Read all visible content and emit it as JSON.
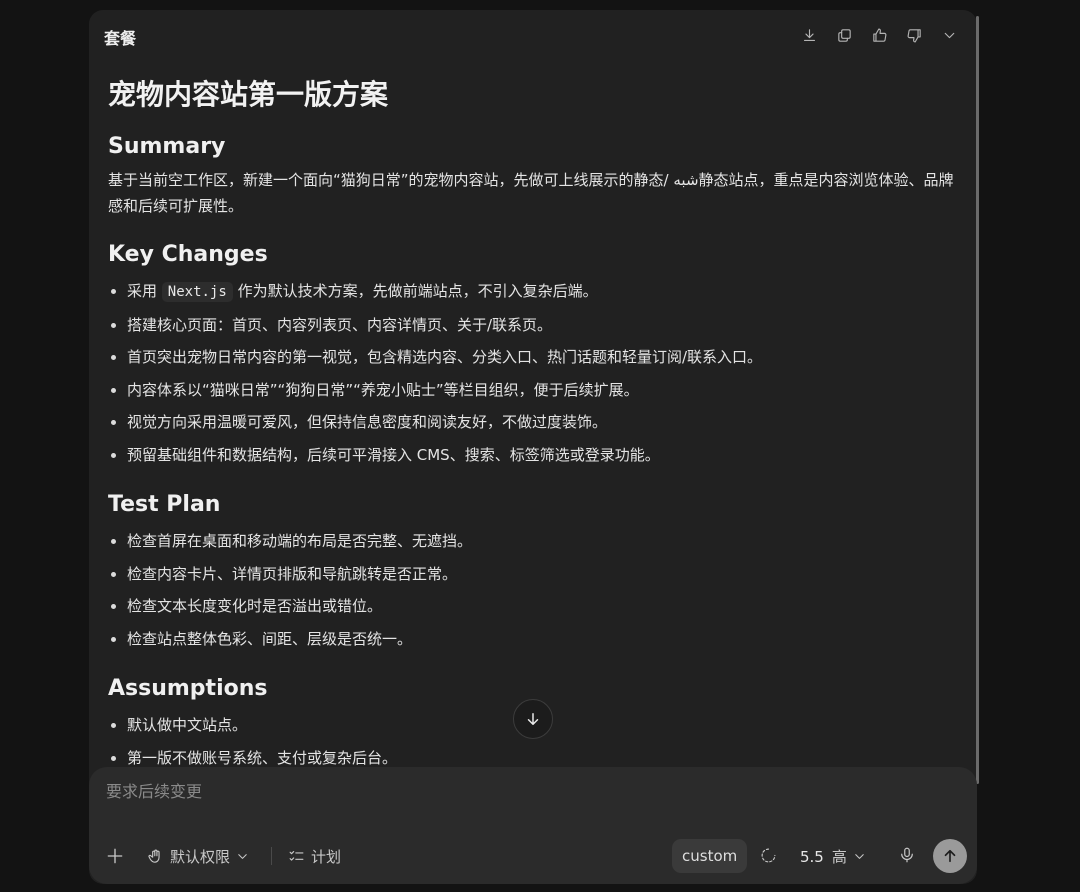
{
  "header": {
    "title": "套餐",
    "icons": [
      "download-icon",
      "copy-icon",
      "thumbs-up-icon",
      "thumbs-down-icon",
      "chevron-down-icon"
    ]
  },
  "doc": {
    "title": "宠物内容站第一版方案",
    "summary": {
      "heading": "Summary",
      "text": "基于当前空工作区，新建一个面向“猫狗日常”的宠物内容站，先做可上线展示的静态/ شبه静态站点，重点是内容浏览体验、品牌感和后续可扩展性。"
    },
    "key_changes": {
      "heading": "Key Changes",
      "items": [
        {
          "before": "采用 ",
          "code": "Next.js",
          "after": " 作为默认技术方案，先做前端站点，不引入复杂后端。"
        },
        {
          "text": "搭建核心页面：首页、内容列表页、内容详情页、关于/联系页。"
        },
        {
          "text": "首页突出宠物日常内容的第一视觉，包含精选内容、分类入口、热门话题和轻量订阅/联系入口。"
        },
        {
          "text": "内容体系以“猫咪日常”“狗狗日常”“养宠小贴士”等栏目组织，便于后续扩展。"
        },
        {
          "text": "视觉方向采用温暖可爱风，但保持信息密度和阅读友好，不做过度装饰。"
        },
        {
          "text": "预留基础组件和数据结构，后续可平滑接入 CMS、搜索、标签筛选或登录功能。"
        }
      ]
    },
    "test_plan": {
      "heading": "Test Plan",
      "items": [
        "检查首屏在桌面和移动端的布局是否完整、无遮挡。",
        "检查内容卡片、详情页排版和导航跳转是否正常。",
        "检查文本长度变化时是否溢出或错位。",
        "检查站点整体色彩、间距、层级是否统一。"
      ]
    },
    "assumptions": {
      "heading": "Assumptions",
      "items": [
        "默认做中文站点。",
        "第一版不做账号系统、支付或复杂后台。"
      ]
    }
  },
  "composer": {
    "placeholder": "要求后续变更",
    "permissions_label": "默认权限",
    "plan_label": "计划",
    "custom_label": "custom",
    "model_version": "5.5",
    "model_level": "高"
  }
}
